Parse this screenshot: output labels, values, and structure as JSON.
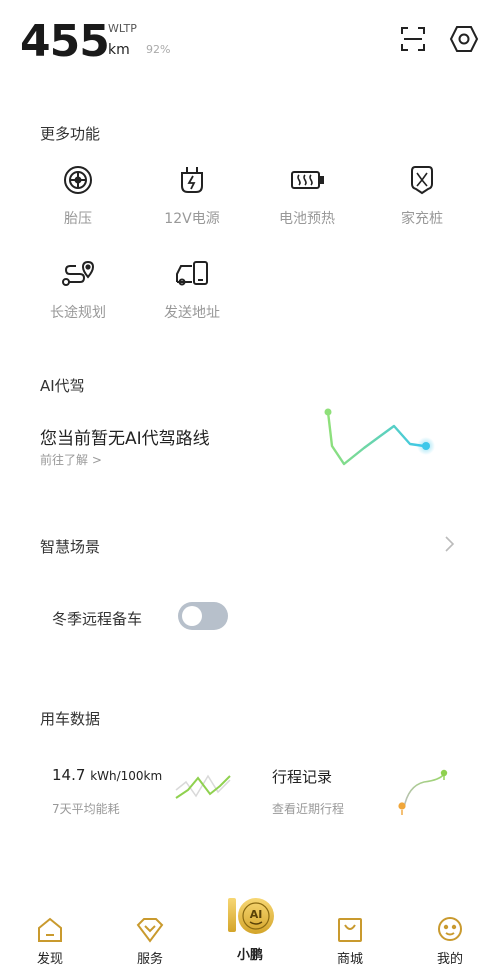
{
  "header": {
    "range_value": "455",
    "range_standard": "WLTP",
    "range_unit": "km",
    "battery_percent": "92%",
    "scan_icon": "scan-icon",
    "settings_icon": "settings-hexagon-icon"
  },
  "more_features": {
    "title": "更多功能",
    "items": [
      {
        "label": "胎压",
        "icon": "tire-icon"
      },
      {
        "label": "12V电源",
        "icon": "plug-icon"
      },
      {
        "label": "电池预热",
        "icon": "battery-heat-icon"
      },
      {
        "label": "家充桩",
        "icon": "charger-icon"
      },
      {
        "label": "长途规划",
        "icon": "route-icon"
      },
      {
        "label": "发送地址",
        "icon": "car-phone-icon"
      }
    ]
  },
  "ai_drive": {
    "title": "AI代驾",
    "message": "您当前暂无AI代驾路线",
    "link": "前往了解 >"
  },
  "smart_scene": {
    "title": "智慧场景",
    "item_label": "冬季远程备车",
    "toggle_on": false
  },
  "car_data": {
    "title": "用车数据",
    "energy_value": "14.7",
    "energy_unit": "kWh/100km",
    "energy_caption": "7天平均能耗",
    "trip_title": "行程记录",
    "trip_caption": "查看近期行程"
  },
  "tabbar": {
    "tabs": [
      {
        "label": "发现",
        "icon": "home-icon"
      },
      {
        "label": "服务",
        "icon": "diamond-icon"
      },
      {
        "label": "小鹏",
        "icon": "ai-badge-icon",
        "badge_text": "AI"
      },
      {
        "label": "商城",
        "icon": "shop-icon"
      },
      {
        "label": "我的",
        "icon": "face-icon"
      }
    ]
  },
  "colors": {
    "accent_gold": "#c99a2e",
    "route_green": "#8fe07a",
    "route_cyan": "#3cc7ea",
    "toggle_off": "#b7c0cb"
  }
}
